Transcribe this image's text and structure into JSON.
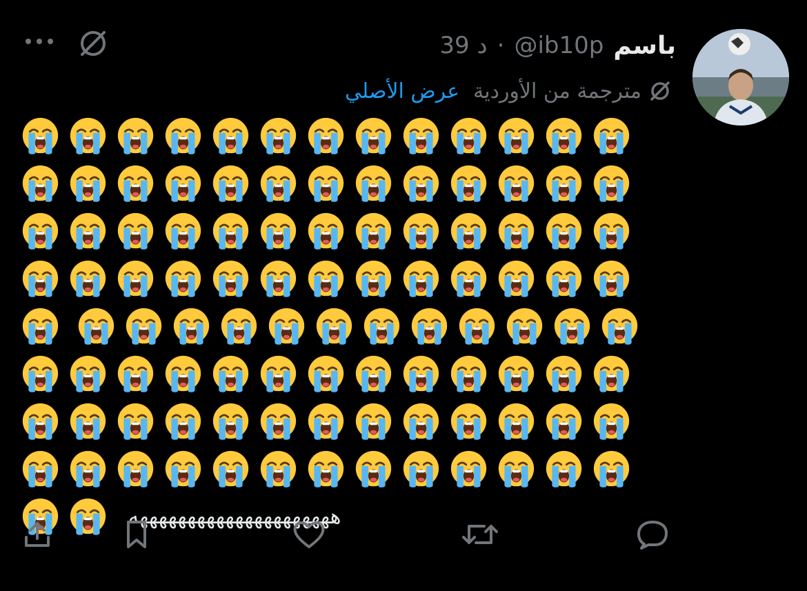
{
  "tweet": {
    "display_name": "باسم",
    "handle": "@ib10p",
    "separator": "·",
    "time": "39 د",
    "translated_label": "مترجمة من الأوردية",
    "show_original": "عرض الأصلي",
    "emoji_rows": [
      13,
      13,
      13,
      13,
      13,
      13,
      13,
      13,
      2
    ],
    "laugh_text": "هههههههههههههههههههههه"
  },
  "icons": {
    "more": "more-icon",
    "translate": "translate-icon",
    "reply": "reply-icon",
    "retweet": "retweet-icon",
    "like": "like-icon",
    "bookmark": "bookmark-icon",
    "share": "share-icon",
    "emoji": "loudly-crying-face-emoji"
  },
  "colors": {
    "background": "#000000",
    "text": "#e7e9ea",
    "muted": "#71767b",
    "link": "#1d9bf0",
    "emoji_face": "#ffcb3d",
    "tears": "#58b7f2"
  }
}
